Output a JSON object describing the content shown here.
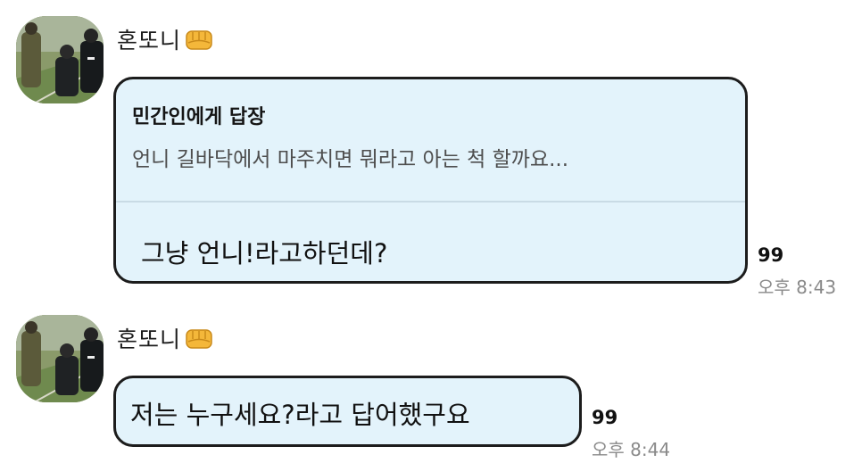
{
  "messages": [
    {
      "sender": "혼또니",
      "sender_badge": "fist-emoji-icon",
      "reply_to_title": "민간인에게 답장",
      "reply_to_quote": "언니 길바닥에서 마주치면 뭐라고 아는 척 할까요...",
      "text": "그냥 언니!라고하던데?",
      "unread_count": "99",
      "time": "오후 8:43"
    },
    {
      "sender": "혼또니",
      "sender_badge": "fist-emoji-icon",
      "text": "저는 누구세요?라고 답어했구요",
      "unread_count": "99",
      "time": "오후 8:44"
    }
  ],
  "colors": {
    "bubble_bg": "#e3f3fb",
    "bubble_border": "#1c1c1c",
    "meta_text": "#8a8a8a"
  }
}
